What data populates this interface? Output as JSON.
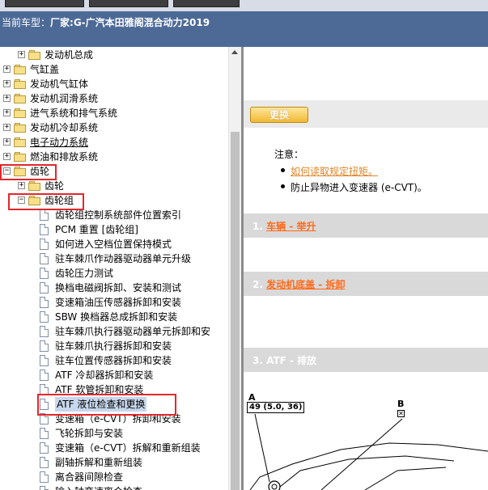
{
  "header": {
    "vehicle_label": "当前车型：",
    "vehicle_value": "厂家:G-广汽本田雅阁混合动力2019"
  },
  "tree": {
    "items": [
      {
        "label": "发动机总成",
        "type": "folder",
        "expander": "+"
      },
      {
        "label": "气缸盖",
        "type": "folder",
        "expander": "+"
      },
      {
        "label": "发动机气缸体",
        "type": "folder",
        "expander": "+"
      },
      {
        "label": "发动机润滑系统",
        "type": "folder",
        "expander": "+"
      },
      {
        "label": "进气系统和排气系统",
        "type": "folder",
        "expander": "+"
      },
      {
        "label": "发动机冷却系统",
        "type": "folder",
        "expander": "+"
      },
      {
        "label": "电子动力系统",
        "type": "folder",
        "expander": "+"
      },
      {
        "label": "燃油和排放系统",
        "type": "folder",
        "expander": "+"
      },
      {
        "label": "齿轮",
        "type": "folder",
        "expander": "−"
      },
      {
        "label": "齿轮",
        "type": "folder",
        "expander": "+"
      },
      {
        "label": "齿轮组",
        "type": "folder",
        "expander": "−"
      },
      {
        "label": "齿轮组控制系统部件位置索引",
        "type": "doc"
      },
      {
        "label": "PCM 重置 [齿轮组]",
        "type": "doc"
      },
      {
        "label": "如何进入空档位置保持模式",
        "type": "doc"
      },
      {
        "label": "驻车棘爪作动器驱动器单元升级",
        "type": "doc"
      },
      {
        "label": "齿轮压力测试",
        "type": "doc"
      },
      {
        "label": "换档电磁阀拆卸、安装和测试",
        "type": "doc"
      },
      {
        "label": "变速箱油压传感器拆卸和安装",
        "type": "doc"
      },
      {
        "label": "SBW 换档器总成拆卸和安装",
        "type": "doc"
      },
      {
        "label": "驻车棘爪执行器驱动器单元拆卸和安",
        "type": "doc"
      },
      {
        "label": "驻车棘爪执行器拆卸和安装",
        "type": "doc"
      },
      {
        "label": "驻车位置传感器拆卸和安装",
        "type": "doc"
      },
      {
        "label": "ATF 冷却器拆卸和安装",
        "type": "doc"
      },
      {
        "label": "ATF 软管拆卸和安装",
        "type": "doc"
      },
      {
        "label": "ATF 液位检查和更换",
        "type": "doc",
        "selected": true
      },
      {
        "label": "变速箱（e-CVT）拆卸和安装",
        "type": "doc"
      },
      {
        "label": "飞轮拆卸与安装",
        "type": "doc"
      },
      {
        "label": "变速箱（e-CVT）拆解和重新组装",
        "type": "doc"
      },
      {
        "label": "副轴拆解和重新组装",
        "type": "doc"
      },
      {
        "label": "离合器间隙检查",
        "type": "doc"
      },
      {
        "label": "输入轴变速离合检查",
        "type": "doc"
      }
    ]
  },
  "content": {
    "update_button": "更换",
    "note_title": "注意：",
    "notes": [
      "如何读取规定扭矩。",
      "防止异物进入变速器 (e-CVT)。"
    ],
    "steps": [
      {
        "number": "1.",
        "link": "车辆 - 举升",
        "rest": ""
      },
      {
        "number": "2.",
        "link": "发动机底盖 - 拆卸",
        "rest": ""
      },
      {
        "number": "3.",
        "link": "",
        "rest": "ATF - 排放"
      }
    ],
    "diagram": {
      "label_a": "A",
      "torque": "49 (5.0, 36)",
      "label_b": "B",
      "label_b_mark": "✕"
    }
  },
  "colors": {
    "header_bg": "#4d6a97",
    "accent_orange": "#ff6a1a",
    "highlight_red": "#e0282c",
    "step_band": "#d9d9d9"
  }
}
